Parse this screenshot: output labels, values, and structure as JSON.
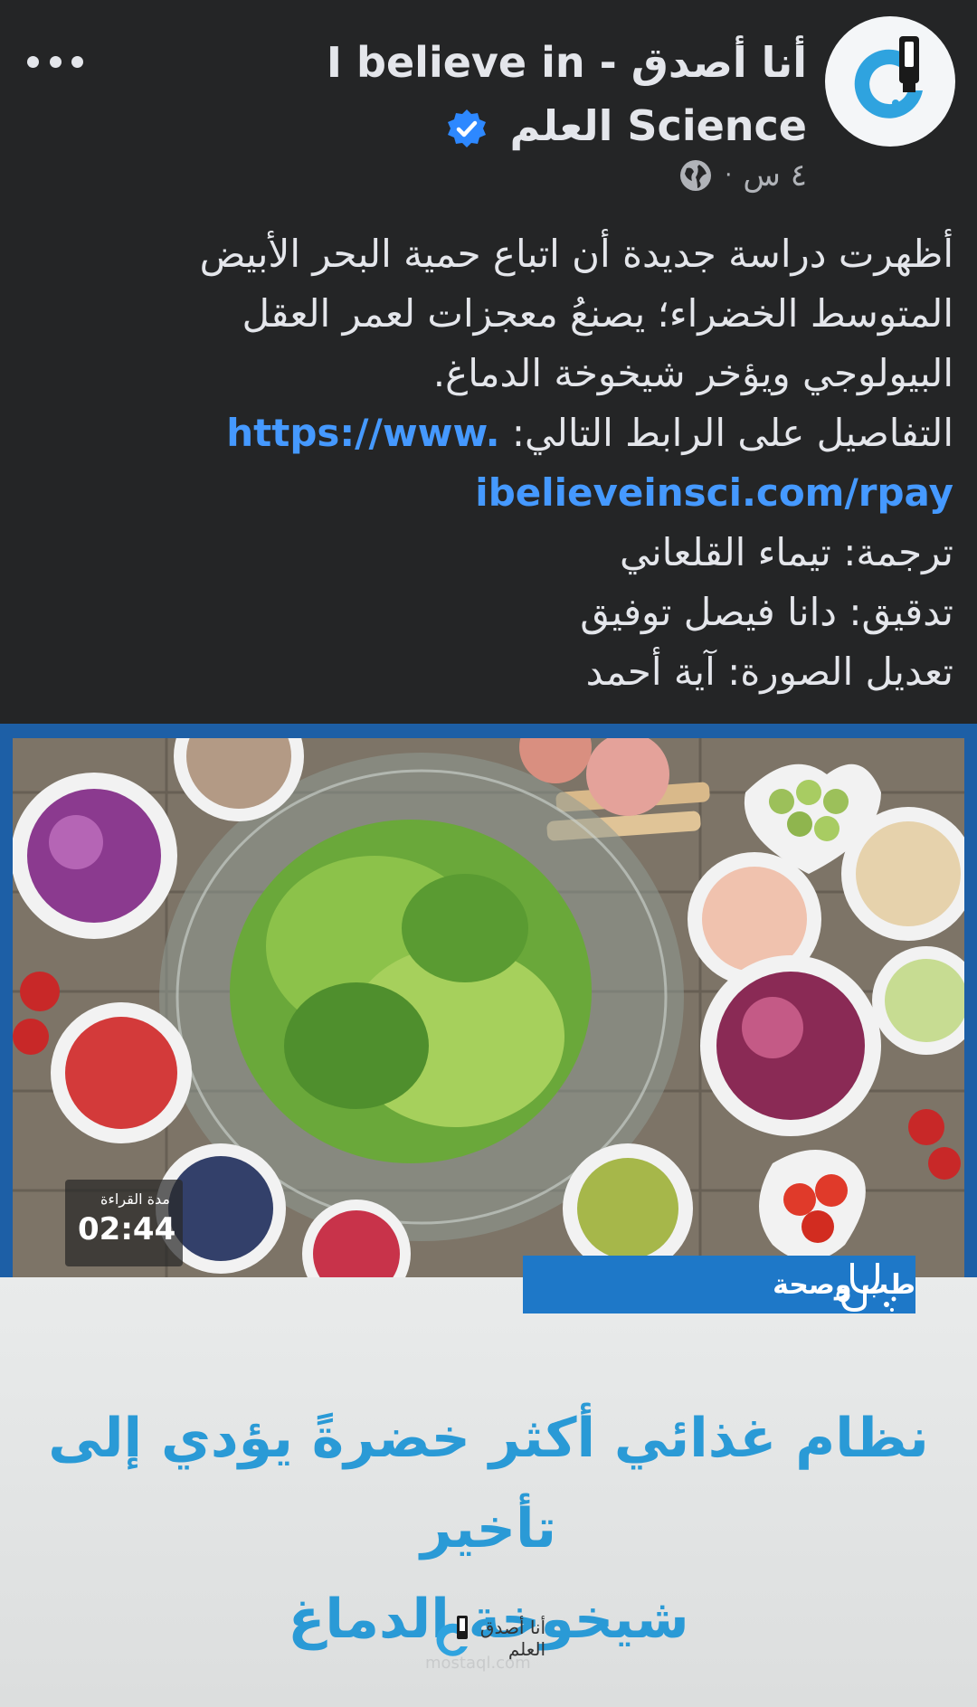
{
  "header": {
    "page_name": "أنا أصدق - I believe in Science العلم",
    "time": "٤ س",
    "separator": "·",
    "more_label": "•••"
  },
  "post": {
    "text_lines": [
      "أظهرت دراسة جديدة أن اتباع حمية البحر الأبيض",
      "المتوسط الخضراء؛ يصنعُ معجزات لعمر العقل",
      "البيولوجي ويؤخر شيخوخة الدماغ."
    ],
    "details_prefix": "التفاصيل على الرابط التالي: ",
    "link_part1": "https://www.",
    "link_part2": "ibelieveinsci.com/rpay",
    "credits": [
      "ترجمة: تيماء القلعاني",
      "تدقيق: دانا فيصل توفيق",
      "تعديل الصورة: آية أحمد"
    ]
  },
  "image_card": {
    "read_time_label": "مدة القراءة",
    "read_time": "02:44",
    "category": "طب وصحة",
    "headline_line1": "نظام غذائي أكثر خضرةً يؤدي إلى تأخير",
    "headline_line2": "شيخوخة الدماغ",
    "logo_text_line1": "أنا أصدق",
    "logo_text_line2": "العلم",
    "watermark": "mostaql.com"
  },
  "colors": {
    "background": "#242526",
    "text": "#e4e6eb",
    "link": "#4599ff",
    "headline": "#2a9ad6",
    "category_bg": "#1e78c8",
    "frame": "#1d5fa6"
  }
}
